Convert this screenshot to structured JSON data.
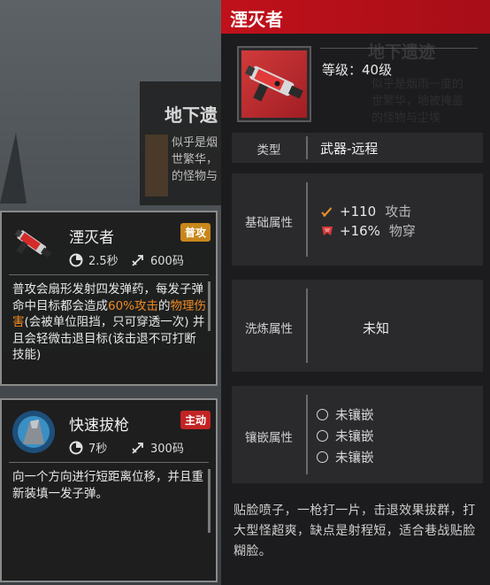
{
  "background": {
    "title": "地下遗",
    "text_lines": [
      "似乎是烟",
      "世繁华，",
      "的怪物与"
    ],
    "ghost_title": "地下遗迹",
    "ghost_lines": [
      "似乎是烟雨一度的",
      "世繁华，地被掩盖",
      "的怪物与尘埃"
    ]
  },
  "skill_cards": [
    {
      "name": "湮灭者",
      "badge": "普攻",
      "cooldown": "2.5秒",
      "range": "600码",
      "desc_part1": "普攻会扇形发射四发弹药，每发子弹命中目标都会造成",
      "desc_hl1": "60%攻击",
      "desc_part2": "的",
      "desc_hl2": "物理伤害",
      "desc_part3": "(会被单位阻挡，只可穿透一次) 并且会轻微击退目标(该击退不可打断技能)"
    },
    {
      "name": "快速拔枪",
      "badge": "主动",
      "cooldown": "7秒",
      "range": "300码",
      "desc": "向一个方向进行短距离位移，并且重新装填一发子弹。"
    }
  ],
  "detail": {
    "title": "湮灭者",
    "level": "等级：40级",
    "type_label": "类型",
    "type_value": "武器-远程",
    "base_label": "基础属性",
    "attrs": [
      {
        "value": "+110",
        "unit": "攻击",
        "icon": "attack-icon"
      },
      {
        "value": "+16%",
        "unit": "物穿",
        "icon": "penetration-icon"
      }
    ],
    "refine_label": "洗炼属性",
    "refine_value": "未知",
    "inlay_label": "镶嵌属性",
    "slots": [
      "未镶嵌",
      "未镶嵌",
      "未镶嵌"
    ],
    "flavor": "贴脸喷子，一枪打一片，击退效果拔群，打大型怪超爽，缺点是射程短，适合巷战贴脸糊脸。"
  },
  "colors": {
    "header_red": "#c0111b",
    "badge_normal": "#c9871b",
    "badge_active": "#c22424",
    "highlight": "#f08a20"
  }
}
